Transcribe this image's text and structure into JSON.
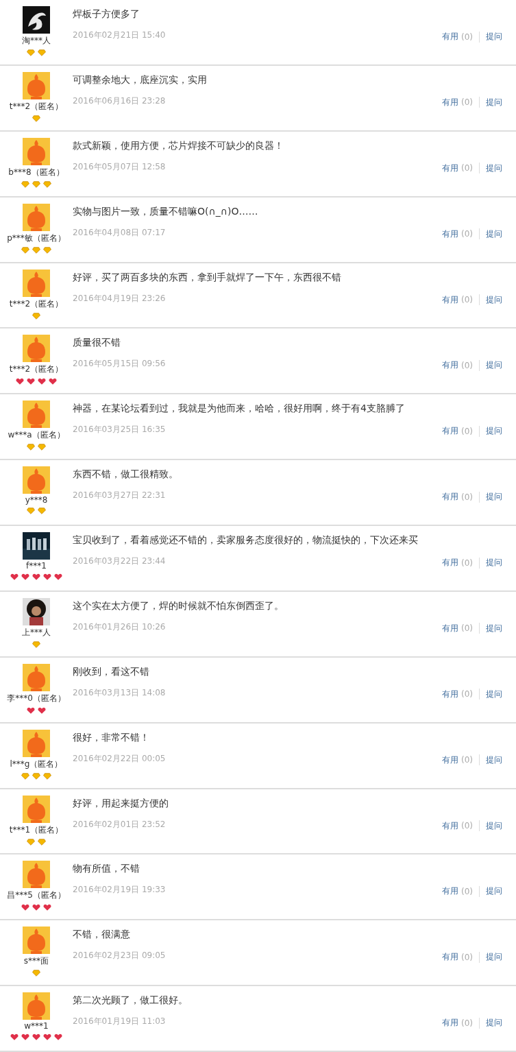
{
  "reviews": [
    {
      "avatar": {
        "kind": "dragon"
      },
      "user": "淘***人",
      "rank_icons": [
        {
          "kind": "diamond"
        },
        {
          "kind": "diamond"
        }
      ],
      "comment": "焊板子方便多了",
      "date": "2016年02月21日 15:40",
      "useful": "有用",
      "useful_count": "(0)",
      "ask": "提问"
    },
    {
      "avatar": {
        "kind": "mascot"
      },
      "user": "t***2（匿名）",
      "rank_icons": [
        {
          "kind": "diamond"
        }
      ],
      "comment": "可调整余地大，底座沉实，实用",
      "date": "2016年06月16日 23:28",
      "useful": "有用",
      "useful_count": "(0)",
      "ask": "提问"
    },
    {
      "avatar": {
        "kind": "mascot"
      },
      "user": "b***8（匿名）",
      "rank_icons": [
        {
          "kind": "diamond"
        },
        {
          "kind": "diamond"
        },
        {
          "kind": "diamond"
        }
      ],
      "comment": "款式新颖，使用方便，芯片焊接不可缺少的良器！",
      "date": "2016年05月07日 12:58",
      "useful": "有用",
      "useful_count": "(0)",
      "ask": "提问"
    },
    {
      "avatar": {
        "kind": "mascot"
      },
      "user": "p***敏（匿名）",
      "rank_icons": [
        {
          "kind": "diamond"
        },
        {
          "kind": "diamond"
        },
        {
          "kind": "diamond"
        }
      ],
      "comment": "实物与图片一致，质量不错嘛O(∩_∩)O……",
      "date": "2016年04月08日 07:17",
      "useful": "有用",
      "useful_count": "(0)",
      "ask": "提问"
    },
    {
      "avatar": {
        "kind": "mascot"
      },
      "user": "t***2（匿名）",
      "rank_icons": [
        {
          "kind": "diamond"
        }
      ],
      "comment": "好评，买了两百多块的东西，拿到手就焊了一下午，东西很不错",
      "date": "2016年04月19日 23:26",
      "useful": "有用",
      "useful_count": "(0)",
      "ask": "提问"
    },
    {
      "avatar": {
        "kind": "mascot"
      },
      "user": "t***2（匿名）",
      "rank_icons": [
        {
          "kind": "heart"
        },
        {
          "kind": "heart"
        },
        {
          "kind": "heart"
        },
        {
          "kind": "heart"
        }
      ],
      "comment": "质量很不错",
      "date": "2016年05月15日 09:56",
      "useful": "有用",
      "useful_count": "(0)",
      "ask": "提问"
    },
    {
      "avatar": {
        "kind": "mascot"
      },
      "user": "w***a（匿名）",
      "rank_icons": [
        {
          "kind": "diamond"
        },
        {
          "kind": "diamond"
        }
      ],
      "comment": "神器，在某论坛看到过，我就是为他而来，哈哈，很好用啊，终于有4支胳膊了",
      "date": "2016年03月25日 16:35",
      "useful": "有用",
      "useful_count": "(0)",
      "ask": "提问"
    },
    {
      "avatar": {
        "kind": "mascot"
      },
      "user": "y***8",
      "rank_icons": [
        {
          "kind": "diamond"
        },
        {
          "kind": "diamond"
        }
      ],
      "comment": "东西不错，做工很精致。",
      "date": "2016年03月27日 22:31",
      "useful": "有用",
      "useful_count": "(0)",
      "ask": "提问"
    },
    {
      "avatar": {
        "kind": "picture"
      },
      "user": "f***1",
      "rank_icons": [
        {
          "kind": "heart"
        },
        {
          "kind": "heart"
        },
        {
          "kind": "heart"
        },
        {
          "kind": "heart"
        },
        {
          "kind": "heart"
        }
      ],
      "comment": "宝贝收到了，看着感觉还不错的，卖家服务态度很好的，物流挺快的，下次还来买",
      "date": "2016年03月22日 23:44",
      "useful": "有用",
      "useful_count": "(0)",
      "ask": "提问"
    },
    {
      "avatar": {
        "kind": "picture"
      },
      "user": "上***人",
      "rank_icons": [
        {
          "kind": "diamond"
        }
      ],
      "comment": "这个实在太方便了，焊的时候就不怕东倒西歪了。",
      "date": "2016年01月26日 10:26",
      "useful": "有用",
      "useful_count": "(0)",
      "ask": "提问"
    },
    {
      "avatar": {
        "kind": "mascot"
      },
      "user": "李***0（匿名）",
      "rank_icons": [
        {
          "kind": "heart"
        },
        {
          "kind": "heart"
        }
      ],
      "comment": "刚收到，看这不错",
      "date": "2016年03月13日 14:08",
      "useful": "有用",
      "useful_count": "(0)",
      "ask": "提问"
    },
    {
      "avatar": {
        "kind": "mascot"
      },
      "user": "l***g（匿名）",
      "rank_icons": [
        {
          "kind": "diamond"
        },
        {
          "kind": "diamond"
        },
        {
          "kind": "diamond"
        }
      ],
      "comment": "很好，非常不错！",
      "date": "2016年02月22日 00:05",
      "useful": "有用",
      "useful_count": "(0)",
      "ask": "提问"
    },
    {
      "avatar": {
        "kind": "mascot"
      },
      "user": "t***1（匿名）",
      "rank_icons": [
        {
          "kind": "diamond"
        },
        {
          "kind": "diamond"
        }
      ],
      "comment": "好评，用起来挺方便的",
      "date": "2016年02月01日 23:52",
      "useful": "有用",
      "useful_count": "(0)",
      "ask": "提问"
    },
    {
      "avatar": {
        "kind": "mascot"
      },
      "user": "昌***5（匿名）",
      "rank_icons": [
        {
          "kind": "heart"
        },
        {
          "kind": "heart"
        },
        {
          "kind": "heart"
        }
      ],
      "comment": "物有所值，不错",
      "date": "2016年02月19日 19:33",
      "useful": "有用",
      "useful_count": "(0)",
      "ask": "提问"
    },
    {
      "avatar": {
        "kind": "mascot"
      },
      "user": "s***面",
      "rank_icons": [
        {
          "kind": "diamond"
        }
      ],
      "comment": "不错，很满意",
      "date": "2016年02月23日 09:05",
      "useful": "有用",
      "useful_count": "(0)",
      "ask": "提问"
    },
    {
      "avatar": {
        "kind": "mascot"
      },
      "user": "w***1",
      "rank_icons": [
        {
          "kind": "heart"
        },
        {
          "kind": "heart"
        },
        {
          "kind": "heart"
        },
        {
          "kind": "heart"
        },
        {
          "kind": "heart"
        }
      ],
      "comment": "第二次光顾了，做工很好。",
      "date": "2016年01月19日 11:03",
      "useful": "有用",
      "useful_count": "(0)",
      "ask": "提问"
    }
  ]
}
